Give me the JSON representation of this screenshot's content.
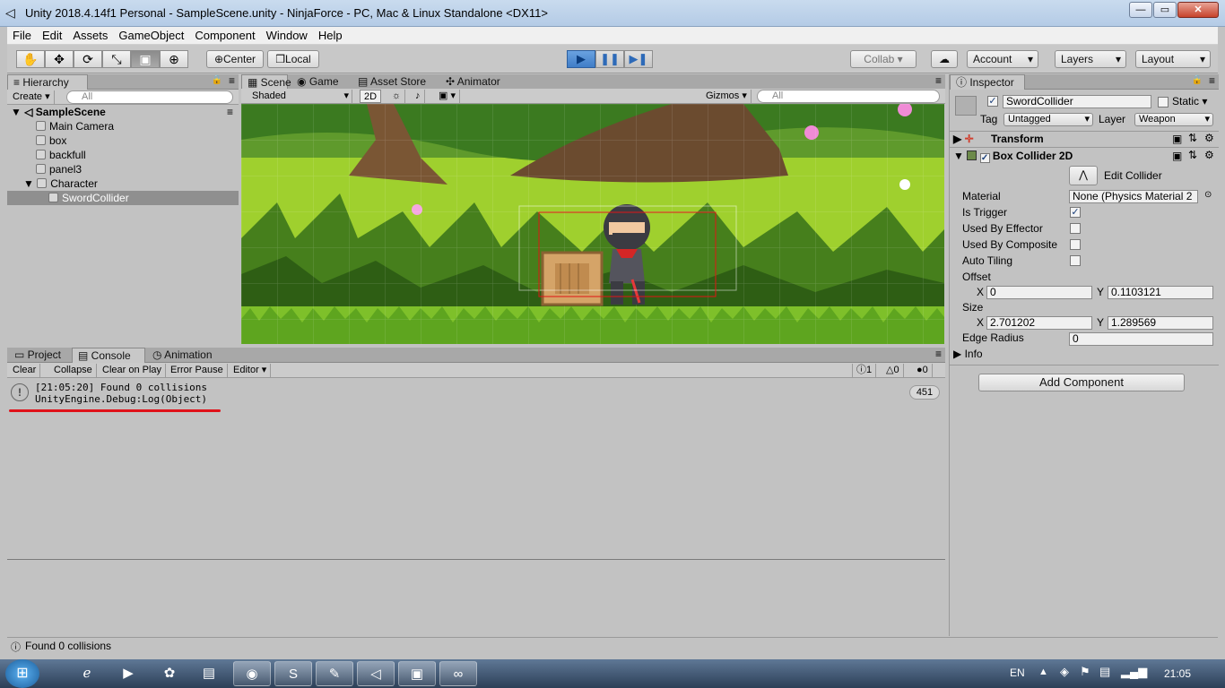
{
  "window": {
    "title": "Unity 2018.4.14f1 Personal - SampleScene.unity - NinjaForce - PC, Mac & Linux Standalone <DX11>",
    "minimize": "—",
    "maximize": "▭",
    "close": "✕"
  },
  "menu": [
    "File",
    "Edit",
    "Assets",
    "GameObject",
    "Component",
    "Window",
    "Help"
  ],
  "toolbar": {
    "pivot": "Center",
    "space": "Local",
    "collab": "Collab ▾",
    "account": "Account",
    "layers": "Layers",
    "layout": "Layout"
  },
  "hierarchy": {
    "tab": "Hierarchy",
    "create": "Create",
    "search_placeholder": "All",
    "scene": "SampleScene",
    "items": [
      "Main Camera",
      "box",
      "backfull",
      "panel3",
      "Character",
      "SwordCollider"
    ],
    "selected": "SwordCollider"
  },
  "scene": {
    "tabs": [
      "Scene",
      "Game",
      "Asset Store",
      "Animator"
    ],
    "shading": "Shaded",
    "mode_2d": "2D",
    "gizmos": "Gizmos",
    "search_placeholder": "All"
  },
  "bottom": {
    "tabs": [
      "Project",
      "Console",
      "Animation"
    ],
    "buttons": [
      "Clear",
      "Collapse",
      "Clear on Play",
      "Error Pause",
      "Editor"
    ],
    "counts": {
      "info": "1",
      "warnings": "0",
      "errors": "0"
    },
    "log_line1": "[21:05:20] Found 0 collisions",
    "log_line2": "UnityEngine.Debug:Log(Object)",
    "log_count": "451"
  },
  "inspector": {
    "tab": "Inspector",
    "object_name": "SwordCollider",
    "static_label": "Static",
    "tag_label": "Tag",
    "tag_value": "Untagged",
    "layer_label": "Layer",
    "layer_value": "Weapon",
    "transform_title": "Transform",
    "collider_title": "Box Collider 2D",
    "edit_collider": "Edit Collider",
    "material_label": "Material",
    "material_value": "None (Physics Material 2",
    "is_trigger": "Is Trigger",
    "used_by_effector": "Used By Effector",
    "used_by_composite": "Used By Composite",
    "auto_tiling": "Auto Tiling",
    "offset_label": "Offset",
    "offset_x": "0",
    "offset_y": "0.1103121",
    "size_label": "Size",
    "size_x": "2.701202",
    "size_y": "1.289569",
    "edge_radius_label": "Edge Radius",
    "edge_radius": "0",
    "info_label": "Info",
    "add_component": "Add Component",
    "x": "X",
    "y": "Y"
  },
  "status": "Found 0 collisions",
  "taskbar": {
    "lang": "EN",
    "time": "21:05"
  },
  "colors": {
    "accent_play": "#3f7dc7",
    "selection": "#8f8f8f",
    "error_underline": "#e0121a"
  }
}
